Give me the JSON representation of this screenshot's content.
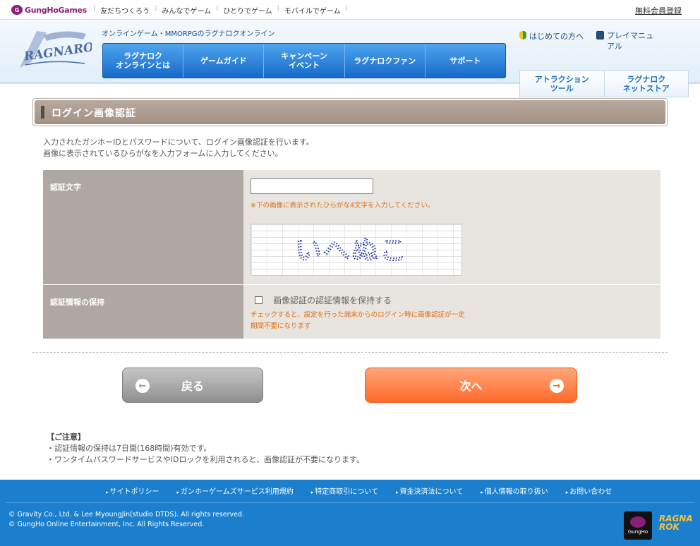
{
  "topbar": {
    "brand": "GungHoGames",
    "brand_mark": "G",
    "links": [
      "友だちつくろう",
      "みんなでゲーム",
      "ひとりでゲーム",
      "モバイルでゲーム"
    ],
    "register": "無料会員登録"
  },
  "header": {
    "logo_text": "RAGNAROK",
    "tagline": "オンラインゲーム・MMORPGのラグナロクオンライン",
    "nav": [
      "ラグナロク\nオンラインとは",
      "ゲームガイド",
      "キャンペーン\nイベント",
      "ラグナロクファン",
      "サポート"
    ],
    "side_links": [
      "はじめての方へ",
      "プレイマニュ\nアル"
    ],
    "sub_buttons": [
      "アトラクション\nツール",
      "ラグナロク\nネットストア"
    ]
  },
  "page": {
    "title": "ログイン画像認証",
    "intro_line1": "入力されたガンホーIDとパスワードについて、ログイン画像認証を行います。",
    "intro_line2": "画像に表示されているひらがなを入力フォームに入力してください。"
  },
  "form": {
    "code_label": "認証文字",
    "code_value": "",
    "code_hint": "※下の画像に表示されたひらがな4文字を入力してください。",
    "captcha_text": "いへぬこ",
    "keep_label": "認証情報の保持",
    "keep_checkbox_label": "画像認証の認証情報を保持する",
    "keep_checked": false,
    "keep_note_line1": "チェックすると、設定を行った端末からのログイン時に画像認証が一定",
    "keep_note_line2": "期間不要になります"
  },
  "buttons": {
    "back_label": "戻る",
    "next_label": "次へ",
    "back_icon": "arrow-left-circle",
    "next_icon": "arrow-right-circle"
  },
  "notes": {
    "title": "【ご注意】",
    "line1": "・認証情報の保持は7日間(168時間)有効です。",
    "line2": "・ワンタイムパスワードサービスやIDロックを利用されると、画像認証が不要になります。"
  },
  "footer": {
    "links": [
      "サイトポリシー",
      "ガンホーゲームズサービス利用規約",
      "特定商取引について",
      "資金決済法について",
      "個人情報の取り扱い",
      "お問い合わせ"
    ],
    "copyright1": "© Gravity Co., Ltd. & Lee MyoungJin(studio DTDS). All rights reserved.",
    "copyright2": "© GungHo Online Entertainment, Inc. All Rights Reserved.",
    "logo1_text": "GungHo",
    "logo2_text": "RAGNA ROK"
  },
  "colors": {
    "accent_blue": "#1c7fcd",
    "next_orange": "#ff6a2b",
    "title_brown": "#a39284",
    "hint_orange": "#e56c0c"
  }
}
